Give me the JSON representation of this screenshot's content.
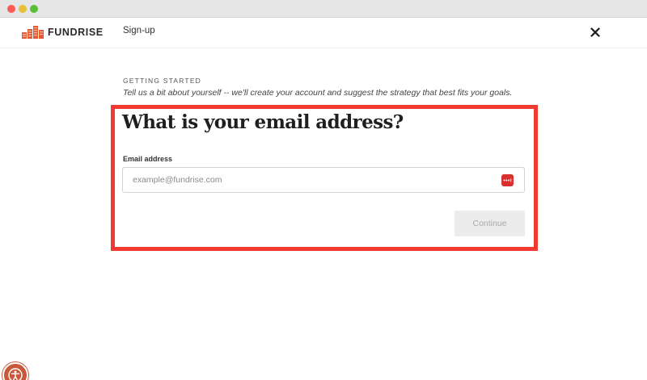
{
  "browser": {
    "controls": [
      "close",
      "minimize",
      "maximize"
    ]
  },
  "header": {
    "logo_text": "FUNDRISE",
    "logo_icon": "buildings-logo-icon",
    "nav_link": "Sign-up",
    "close_icon": "close-icon"
  },
  "step": {
    "eyebrow": "GETTING STARTED",
    "intro": "Tell us a bit about yourself -- we'll create your account and suggest the strategy that best fits your goals."
  },
  "form": {
    "question": "What is your email address?",
    "email_label": "Email address",
    "email_placeholder": "example@fundrise.com",
    "email_value": "",
    "password_manager_icon": "password-manager-icon",
    "continue_label": "Continue",
    "continue_disabled": true
  },
  "accessibility": {
    "icon": "accessibility-icon"
  },
  "colors": {
    "brand": "#e05a33",
    "highlight": "#f23a32",
    "button_bg": "#ececec",
    "button_text": "#a8a8a8"
  }
}
